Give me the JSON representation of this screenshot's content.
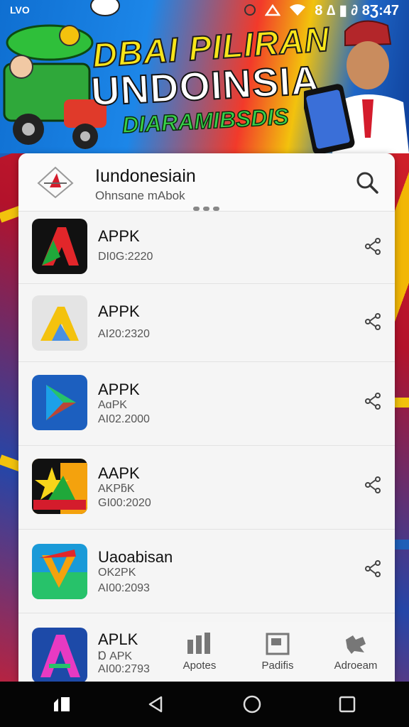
{
  "status_bar": {
    "left_text": "LVO",
    "right_text": "8 ∆ ▮ ∂ 8Ʒ:47"
  },
  "banner": {
    "title_line1": "DBAI PILIRAN",
    "title_line2": "UNDOINSIA",
    "title_line3": "DIARAMIBSDIS"
  },
  "header": {
    "title": "Iundonesiain",
    "subtitle": "Ohnsɑne mAbok"
  },
  "apps": [
    {
      "name": "APPK",
      "line2": "",
      "line3": "DI0G:2220",
      "icon": "red-green-a-icon"
    },
    {
      "name": "APPK",
      "line2": "",
      "line3": "AI20:2320",
      "icon": "yellow-a-icon"
    },
    {
      "name": "APPK",
      "line2": "AɑPK",
      "line3": "AI02.2000",
      "icon": "play-triangle-icon"
    },
    {
      "name": "AAPK",
      "line2": "AKPƃK",
      "line3": "GI00:2020",
      "icon": "star-badge-icon"
    },
    {
      "name": "Uaoabisan",
      "line2": "OK2PK",
      "line3": "AI00:2093",
      "icon": "v-logo-icon"
    },
    {
      "name": "APLK",
      "line2": "Ɒ APK",
      "line3": "AI00:2793",
      "icon": "colorful-a-icon"
    }
  ],
  "tabbar": [
    {
      "label": "Apotes",
      "icon": "chart-icon"
    },
    {
      "label": "Padifis",
      "icon": "document-icon"
    },
    {
      "label": "Adroeam",
      "icon": "puzzle-icon"
    }
  ],
  "colors": {
    "accent_red": "#d8132a",
    "accent_yellow": "#f4c20d",
    "accent_blue": "#1f5fb8"
  }
}
